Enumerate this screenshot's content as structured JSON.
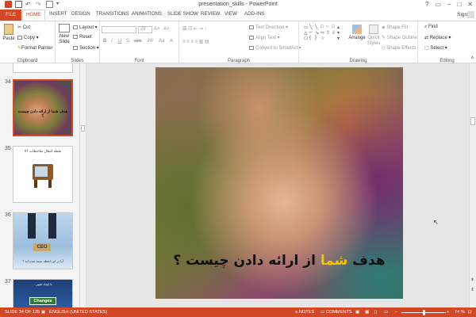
{
  "window": {
    "title": "presentation_skills - PowerPoint",
    "signin": "Sign in"
  },
  "tabs": [
    "FILE",
    "HOME",
    "INSERT",
    "DESIGN",
    "TRANSITIONS",
    "ANIMATIONS",
    "SLIDE SHOW",
    "REVIEW",
    "VIEW",
    "ADD-INS"
  ],
  "ribbon": {
    "clipboard": {
      "label": "Clipboard",
      "paste": "Paste",
      "cut": "Cut",
      "copy": "Copy",
      "format_painter": "Format Painter"
    },
    "slides": {
      "label": "Slides",
      "new_slide": "New Slide",
      "layout": "Layout",
      "reset": "Reset",
      "section": "Section"
    },
    "font": {
      "label": "Font",
      "size": "28"
    },
    "paragraph": {
      "label": "Paragraph",
      "text_direction": "Text Direction",
      "align_text": "Align Text",
      "convert_smartart": "Convert to SmartArt"
    },
    "drawing": {
      "label": "Drawing",
      "arrange": "Arrange",
      "quick_styles": "Quick Styles",
      "shape_fill": "Shape Fill",
      "shape_outline": "Shape Outline",
      "shape_effects": "Shape Effects"
    },
    "editing": {
      "label": "Editing",
      "find": "Find",
      "replace": "Replace",
      "select": "Select"
    }
  },
  "thumbnails": [
    {
      "number": "34",
      "text": "هدف شما از ارائه دادن چیست ؟"
    },
    {
      "number": "35",
      "text": "نقطه انتقال ملاحظات ؟!!"
    },
    {
      "number": "36",
      "text": "CEO",
      "caption": "آیا در این لحظه بسته شده اید ؟"
    },
    {
      "number": "37",
      "text": "Changes",
      "caption": "با ایجاد تغییر..."
    }
  ],
  "slide": {
    "text_part1": "هدف",
    "text_highlight": "شما",
    "text_part2": "از ارائه دادن چیست ؟"
  },
  "status": {
    "slide": "SLIDE 34 OF 135",
    "language": "ENGLISH (UNITED STATES)",
    "notes": "NOTES",
    "comments": "COMMENTS",
    "zoom": "74 %"
  },
  "colors": {
    "accent": "#d24726",
    "highlight_text": "#f5c400"
  }
}
